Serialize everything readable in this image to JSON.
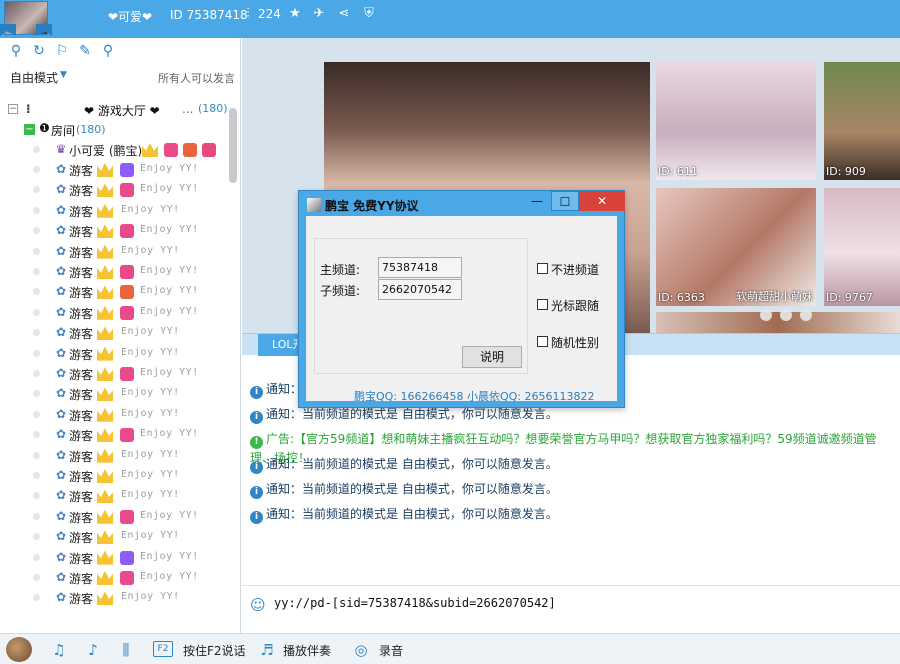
{
  "topbar": {
    "name": "❤可爱❤",
    "id_text": "ID 75387418",
    "fans": "224"
  },
  "left": {
    "mode_label": "自由模式",
    "mode_right": "所有人可以发言",
    "hall": {
      "prefix": "⁝",
      "label": "❤ 游戏大厅 ❤",
      "suffix": "...",
      "count": "(180)"
    },
    "room": {
      "label": "房间",
      "count": "(180)"
    },
    "first_user": "小可爱 (鹏宝)",
    "user_label": "游客",
    "enjoy": "Enjoy YY!"
  },
  "photos": {
    "captions": [
      "ID: 611",
      "ID: 909",
      "ID: 6363",
      "软萌超甜小萌妹",
      "ID: 9767"
    ]
  },
  "tab": {
    "label": "LOL开"
  },
  "chat": {
    "notice_prefix": "通知：",
    "notice_text": "当前频道的模式是 自由模式，你可以随意发言。",
    "ad": "广告:【官方59频道】想和萌妹主播疯狂互动吗？想要荣誉官方马甲吗？想获取官方独家福利吗？59频道诚邀频道管理、场控！"
  },
  "input": {
    "text": "yy://pd-[sid=75387418&subid=2662070542]"
  },
  "bottom": {
    "f2_key": "F2",
    "talk_label": "按住F2说话",
    "accompany_label": "播放伴奏",
    "record_label": "录音"
  },
  "dialog": {
    "title": "鹏宝 免费YY协议",
    "main_channel_label": "主频道:",
    "main_channel_value": "75387418",
    "sub_channel_label": "子频道:",
    "sub_channel_value": "2662070542",
    "explain": "说明",
    "chk_no_enter": "不进频道",
    "chk_cursor": "光标跟随",
    "chk_gender": "随机性别",
    "qq_line": "鹏宝QQ: 166266458 小晨依QQ: 2656113822"
  }
}
